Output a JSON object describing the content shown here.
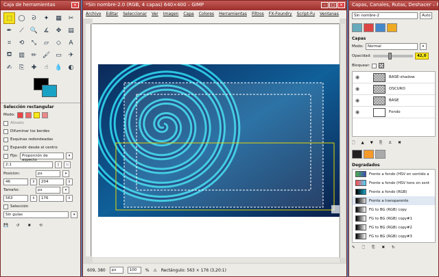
{
  "toolbox": {
    "title": "Caja de herramientas",
    "section_title": "Selección rectangular",
    "mode_label": "Modo:",
    "antialias": "Alisado",
    "feather": "Difuminar los bordes",
    "rounded": "Esquinas redondeadas",
    "expand_center": "Expandir desde el centro",
    "fixed_label": "Fijo:",
    "fixed_value": "Proporción de aspecto",
    "ratio": "2:1",
    "position_label": "Posicion:",
    "position_unit": "px",
    "pos_x": "46",
    "pos_y": "204",
    "size_label": "Tamaño:",
    "size_unit": "px",
    "size_w": "563",
    "size_h": "176",
    "selection_label": "Selección",
    "guides": "Sin guías"
  },
  "image": {
    "title": "*Sin nombre-2.0 (RGB, 4 capas) 640×400 – GIMP",
    "menu": [
      "Archivo",
      "Editar",
      "Seleccionar",
      "Ver",
      "Imagen",
      "Capa",
      "Colores",
      "Herramientas",
      "Filtros",
      "FX-Foundry",
      "Script-Fu",
      "Ventanas"
    ],
    "coords": "609, 380",
    "unit": "px",
    "zoom": "100",
    "zoom_unit": "%",
    "status_text": "Rectángulo: 563 × 176  (3,20:1)"
  },
  "layers": {
    "title": "Capas, Canales, Rutas, Deshacer – Pi",
    "image_select": "Sin nombre-2",
    "auto_label": "Auto",
    "section": "Capas",
    "mode_label": "Modo:",
    "mode_value": "Normal",
    "opacity_label": "Opacidad:",
    "opacity_value": "42,0",
    "lock_label": "Bloquear:",
    "items": [
      {
        "name": "BASE-shadow",
        "thumb": "checker"
      },
      {
        "name": "OSCURO",
        "thumb": "checker"
      },
      {
        "name": "BASE",
        "thumb": "checker"
      },
      {
        "name": "Fondo",
        "thumb": "white"
      }
    ],
    "gradients_title": "Degradados",
    "gradients": [
      {
        "name": "Frente a fondo (HSV en sentido a",
        "c1": "#4caf50",
        "c2": "#3f51b5"
      },
      {
        "name": "Frente a fondo (HSV tono en sent",
        "c1": "#ff4d4d",
        "c2": "#4dd2ff"
      },
      {
        "name": "Frente a fondo (RGB)",
        "c1": "#000000",
        "c2": "#1aa2c4"
      },
      {
        "name": "Frente a transparente",
        "c1": "#000000",
        "c2": "#dddddd"
      },
      {
        "name": "FG to BG (RGB) copy",
        "c1": "#000000",
        "c2": "#ffffff"
      },
      {
        "name": "FG to BG (RGB) copy#1",
        "c1": "#000000",
        "c2": "#ffffff"
      },
      {
        "name": "FG to BG (RGB) copy#2",
        "c1": "#000000",
        "c2": "#ffffff"
      },
      {
        "name": "FG to BG (RGB) copy#3",
        "c1": "#000000",
        "c2": "#ffffff"
      }
    ]
  }
}
